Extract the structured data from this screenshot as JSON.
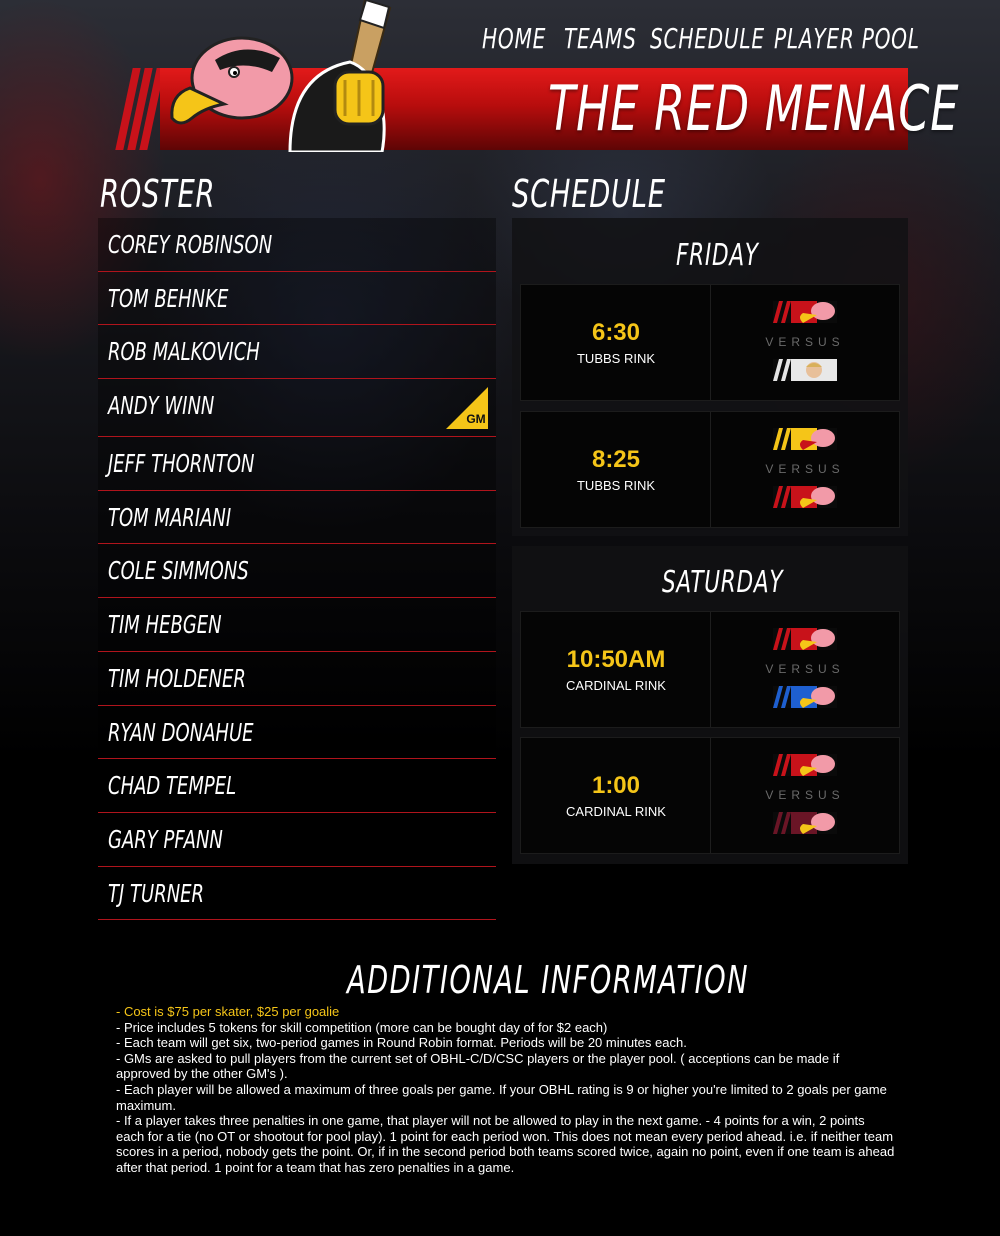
{
  "nav": {
    "items": [
      {
        "label": "HOME"
      },
      {
        "label": "TEAMS"
      },
      {
        "label": "SCHEDULE"
      },
      {
        "label": "PLAYER POOL"
      }
    ]
  },
  "banner": {
    "title": "THE RED MENACE",
    "color": "#c8121a"
  },
  "roster": {
    "heading": "ROSTER",
    "gm_badge": "GM",
    "players": [
      {
        "name": "COREY ROBINSON"
      },
      {
        "name": "TOM BEHNKE"
      },
      {
        "name": "ROB MALKOVICH"
      },
      {
        "name": "ANDY WINN",
        "is_gm": true
      },
      {
        "name": "JEFF THORNTON"
      },
      {
        "name": "TOM MARIANI"
      },
      {
        "name": "COLE SIMMONS"
      },
      {
        "name": "TIM HEBGEN"
      },
      {
        "name": "TIM HOLDENER"
      },
      {
        "name": "RYAN DONAHUE"
      },
      {
        "name": "CHAD TEMPEL"
      },
      {
        "name": "GARY PFANN"
      },
      {
        "name": "TJ TURNER"
      }
    ]
  },
  "schedule": {
    "heading": "SCHEDULE",
    "versus_label": "VERSUS",
    "days": [
      {
        "day": "FRIDAY",
        "games": [
          {
            "time": "6:30",
            "rink": "TUBBS RINK",
            "team_a_icon": "red-eagle-logo-icon",
            "team_b_icon": "white-player-photo-logo-icon"
          },
          {
            "time": "8:25",
            "rink": "TUBBS RINK",
            "team_a_icon": "yellow-eagle-logo-icon",
            "team_b_icon": "red-eagle-logo-icon"
          }
        ]
      },
      {
        "day": "SATURDAY",
        "games": [
          {
            "time": "10:50AM",
            "rink": "CARDINAL RINK",
            "team_a_icon": "red-eagle-logo-icon",
            "team_b_icon": "blue-eagle-logo-icon"
          },
          {
            "time": "1:00",
            "rink": "CARDINAL RINK",
            "team_a_icon": "red-eagle-logo-icon",
            "team_b_icon": "maroon-eagle-logo-icon"
          }
        ]
      }
    ]
  },
  "additional": {
    "heading": "ADDITIONAL INFORMATION",
    "highlight_color": "#f5c518",
    "lines": [
      "- Cost is $75 per skater, $25 per goalie",
      "- Price includes 5 tokens for skill competition (more can be bought day of for $2 each)",
      "- Each team will get six, two-period games in Round Robin format. Periods will be 20 minutes each.",
      "- GMs are asked to pull players from the current set of OBHL-C/D/CSC players or the player pool. ( acceptions can be made if approved by the other GM's ).",
      "- Each player will be allowed a maximum of three goals per game. If your OBHL rating is 9 or higher you're limited to 2 goals per game maximum.",
      "- If a player takes three penalties in one game, that player will not be allowed to play in the next game. - 4 points for a win, 2 points each for a tie (no OT or shootout for pool play). 1 point for each period won. This does not mean every period ahead. i.e. if neither team scores in a period, nobody gets the point. Or, if in the second period both teams scored twice, again no point, even if one team is ahead after that period. 1 point for a team that has zero penalties in a game."
    ]
  }
}
